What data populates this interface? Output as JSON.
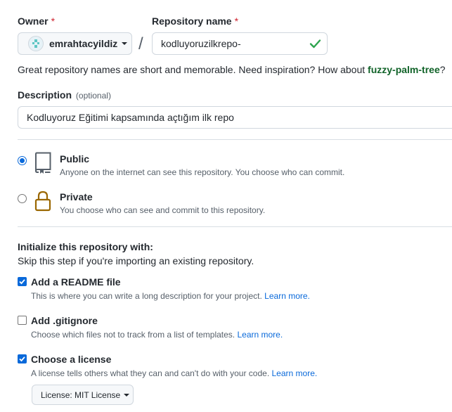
{
  "owner": {
    "label": "Owner",
    "required_mark": "*",
    "username": "emrahtacyildiz",
    "avatar_icon": "identicon-avatar"
  },
  "slash": "/",
  "repository": {
    "label": "Repository name",
    "required_mark": "*",
    "value": "kodluyoruzilkrepo-",
    "valid_icon": "check-icon",
    "valid_color": "#2da44e"
  },
  "suggestion": {
    "text": "Great repository names are short and memorable. Need inspiration? How about ",
    "name": "fuzzy-palm-tree",
    "name_color": "#116329",
    "end": "?"
  },
  "description": {
    "label": "Description",
    "optional": "(optional)",
    "value": "Kodluyoruz Eğitimi kapsamında açtığım ilk repo"
  },
  "visibility": {
    "selected": "public",
    "public": {
      "title": "Public",
      "desc": "Anyone on the internet can see this repository. You choose who can commit.",
      "icon": "repo-book-icon"
    },
    "private": {
      "title": "Private",
      "desc": "You choose who can see and commit to this repository.",
      "icon": "lock-icon",
      "icon_color": "#9a6700"
    }
  },
  "initialize": {
    "heading": "Initialize this repository with:",
    "sub": "Skip this step if you're importing an existing repository.",
    "readme": {
      "title": "Add a README file",
      "desc": "This is where you can write a long description for your project.",
      "link": "Learn more.",
      "checked": true
    },
    "gitignore": {
      "title": "Add .gitignore",
      "desc": "Choose which files not to track from a list of templates.",
      "link": "Learn more.",
      "checked": false
    },
    "license": {
      "title": "Choose a license",
      "desc": "A license tells others what they can and can't do with your code.",
      "link": "Learn more.",
      "checked": true,
      "button_label": "License: MIT License"
    }
  },
  "colors": {
    "accent": "#0969da",
    "danger": "#cf222e"
  }
}
